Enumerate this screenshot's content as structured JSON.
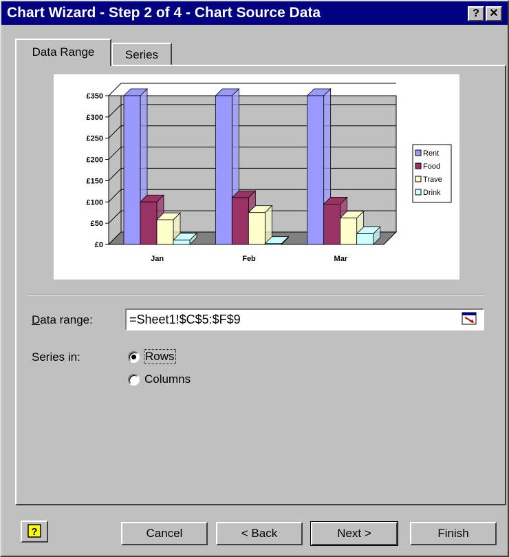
{
  "window": {
    "title": "Chart Wizard - Step 2 of 4 - Chart Source Data",
    "help_glyph": "?",
    "close_glyph": "✕"
  },
  "tabs": [
    {
      "label": "Data Range",
      "active": true
    },
    {
      "label": "Series",
      "active": false
    }
  ],
  "chart_data": {
    "type": "bar",
    "categories": [
      "Jan",
      "Feb",
      "Mar"
    ],
    "series": [
      {
        "name": "Rent",
        "color": "#9999ff",
        "values": [
          350,
          350,
          350
        ]
      },
      {
        "name": "Food",
        "color": "#993366",
        "values": [
          100,
          110,
          95
        ]
      },
      {
        "name": "Trave",
        "color": "#ffffcc",
        "values": [
          58,
          75,
          62
        ]
      },
      {
        "name": "Drink",
        "color": "#ccffff",
        "values": [
          10,
          2,
          25
        ]
      }
    ],
    "yticks": [
      "£0",
      "£50",
      "£100",
      "£150",
      "£200",
      "£250",
      "£300",
      "£350"
    ],
    "ylim": [
      0,
      350
    ],
    "legend": "right",
    "grid": true
  },
  "form": {
    "data_range_label": "Data range:",
    "data_range_value": "=Sheet1!$C$5:$F$9",
    "series_in_label": "Series in:",
    "rows_label": "Rows",
    "columns_label": "Columns",
    "selected": "Rows"
  },
  "buttons": {
    "help": "?",
    "cancel": "Cancel",
    "back": "< Back",
    "next": "Next >",
    "finish": "Finish"
  }
}
